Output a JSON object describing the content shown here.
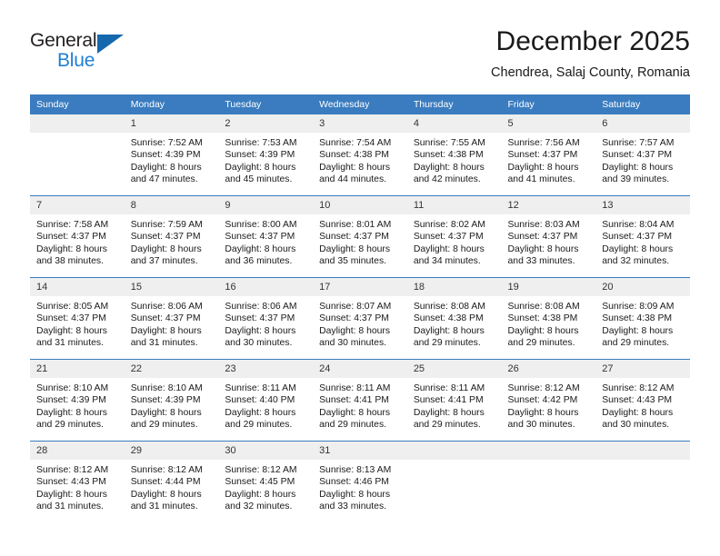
{
  "brand": {
    "name_part1": "General",
    "name_part2": "Blue",
    "triangle_icon": "triangle-logo-icon",
    "accent_color": "#1668ad",
    "blue_text_color": "#1f7fd4"
  },
  "header": {
    "title": "December 2025",
    "subtitle": "Chendrea, Salaj County, Romania"
  },
  "calendar": {
    "header_bg": "#3a7cbf",
    "daynum_bg": "#efefef",
    "weekday_headers": [
      "Sunday",
      "Monday",
      "Tuesday",
      "Wednesday",
      "Thursday",
      "Friday",
      "Saturday"
    ],
    "weeks": [
      [
        {
          "day": "",
          "lines": []
        },
        {
          "day": "1",
          "lines": [
            "Sunrise: 7:52 AM",
            "Sunset: 4:39 PM",
            "Daylight: 8 hours",
            "and 47 minutes."
          ]
        },
        {
          "day": "2",
          "lines": [
            "Sunrise: 7:53 AM",
            "Sunset: 4:39 PM",
            "Daylight: 8 hours",
            "and 45 minutes."
          ]
        },
        {
          "day": "3",
          "lines": [
            "Sunrise: 7:54 AM",
            "Sunset: 4:38 PM",
            "Daylight: 8 hours",
            "and 44 minutes."
          ]
        },
        {
          "day": "4",
          "lines": [
            "Sunrise: 7:55 AM",
            "Sunset: 4:38 PM",
            "Daylight: 8 hours",
            "and 42 minutes."
          ]
        },
        {
          "day": "5",
          "lines": [
            "Sunrise: 7:56 AM",
            "Sunset: 4:37 PM",
            "Daylight: 8 hours",
            "and 41 minutes."
          ]
        },
        {
          "day": "6",
          "lines": [
            "Sunrise: 7:57 AM",
            "Sunset: 4:37 PM",
            "Daylight: 8 hours",
            "and 39 minutes."
          ]
        }
      ],
      [
        {
          "day": "7",
          "lines": [
            "Sunrise: 7:58 AM",
            "Sunset: 4:37 PM",
            "Daylight: 8 hours",
            "and 38 minutes."
          ]
        },
        {
          "day": "8",
          "lines": [
            "Sunrise: 7:59 AM",
            "Sunset: 4:37 PM",
            "Daylight: 8 hours",
            "and 37 minutes."
          ]
        },
        {
          "day": "9",
          "lines": [
            "Sunrise: 8:00 AM",
            "Sunset: 4:37 PM",
            "Daylight: 8 hours",
            "and 36 minutes."
          ]
        },
        {
          "day": "10",
          "lines": [
            "Sunrise: 8:01 AM",
            "Sunset: 4:37 PM",
            "Daylight: 8 hours",
            "and 35 minutes."
          ]
        },
        {
          "day": "11",
          "lines": [
            "Sunrise: 8:02 AM",
            "Sunset: 4:37 PM",
            "Daylight: 8 hours",
            "and 34 minutes."
          ]
        },
        {
          "day": "12",
          "lines": [
            "Sunrise: 8:03 AM",
            "Sunset: 4:37 PM",
            "Daylight: 8 hours",
            "and 33 minutes."
          ]
        },
        {
          "day": "13",
          "lines": [
            "Sunrise: 8:04 AM",
            "Sunset: 4:37 PM",
            "Daylight: 8 hours",
            "and 32 minutes."
          ]
        }
      ],
      [
        {
          "day": "14",
          "lines": [
            "Sunrise: 8:05 AM",
            "Sunset: 4:37 PM",
            "Daylight: 8 hours",
            "and 31 minutes."
          ]
        },
        {
          "day": "15",
          "lines": [
            "Sunrise: 8:06 AM",
            "Sunset: 4:37 PM",
            "Daylight: 8 hours",
            "and 31 minutes."
          ]
        },
        {
          "day": "16",
          "lines": [
            "Sunrise: 8:06 AM",
            "Sunset: 4:37 PM",
            "Daylight: 8 hours",
            "and 30 minutes."
          ]
        },
        {
          "day": "17",
          "lines": [
            "Sunrise: 8:07 AM",
            "Sunset: 4:37 PM",
            "Daylight: 8 hours",
            "and 30 minutes."
          ]
        },
        {
          "day": "18",
          "lines": [
            "Sunrise: 8:08 AM",
            "Sunset: 4:38 PM",
            "Daylight: 8 hours",
            "and 29 minutes."
          ]
        },
        {
          "day": "19",
          "lines": [
            "Sunrise: 8:08 AM",
            "Sunset: 4:38 PM",
            "Daylight: 8 hours",
            "and 29 minutes."
          ]
        },
        {
          "day": "20",
          "lines": [
            "Sunrise: 8:09 AM",
            "Sunset: 4:38 PM",
            "Daylight: 8 hours",
            "and 29 minutes."
          ]
        }
      ],
      [
        {
          "day": "21",
          "lines": [
            "Sunrise: 8:10 AM",
            "Sunset: 4:39 PM",
            "Daylight: 8 hours",
            "and 29 minutes."
          ]
        },
        {
          "day": "22",
          "lines": [
            "Sunrise: 8:10 AM",
            "Sunset: 4:39 PM",
            "Daylight: 8 hours",
            "and 29 minutes."
          ]
        },
        {
          "day": "23",
          "lines": [
            "Sunrise: 8:11 AM",
            "Sunset: 4:40 PM",
            "Daylight: 8 hours",
            "and 29 minutes."
          ]
        },
        {
          "day": "24",
          "lines": [
            "Sunrise: 8:11 AM",
            "Sunset: 4:41 PM",
            "Daylight: 8 hours",
            "and 29 minutes."
          ]
        },
        {
          "day": "25",
          "lines": [
            "Sunrise: 8:11 AM",
            "Sunset: 4:41 PM",
            "Daylight: 8 hours",
            "and 29 minutes."
          ]
        },
        {
          "day": "26",
          "lines": [
            "Sunrise: 8:12 AM",
            "Sunset: 4:42 PM",
            "Daylight: 8 hours",
            "and 30 minutes."
          ]
        },
        {
          "day": "27",
          "lines": [
            "Sunrise: 8:12 AM",
            "Sunset: 4:43 PM",
            "Daylight: 8 hours",
            "and 30 minutes."
          ]
        }
      ],
      [
        {
          "day": "28",
          "lines": [
            "Sunrise: 8:12 AM",
            "Sunset: 4:43 PM",
            "Daylight: 8 hours",
            "and 31 minutes."
          ]
        },
        {
          "day": "29",
          "lines": [
            "Sunrise: 8:12 AM",
            "Sunset: 4:44 PM",
            "Daylight: 8 hours",
            "and 31 minutes."
          ]
        },
        {
          "day": "30",
          "lines": [
            "Sunrise: 8:12 AM",
            "Sunset: 4:45 PM",
            "Daylight: 8 hours",
            "and 32 minutes."
          ]
        },
        {
          "day": "31",
          "lines": [
            "Sunrise: 8:13 AM",
            "Sunset: 4:46 PM",
            "Daylight: 8 hours",
            "and 33 minutes."
          ]
        },
        {
          "day": "",
          "lines": []
        },
        {
          "day": "",
          "lines": []
        },
        {
          "day": "",
          "lines": []
        }
      ]
    ]
  }
}
